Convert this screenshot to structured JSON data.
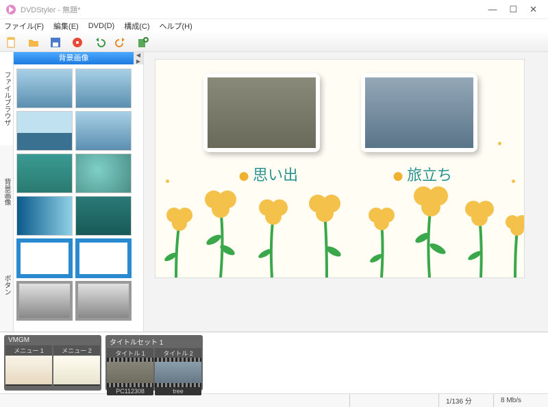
{
  "titlebar": {
    "text": "DVDStyler - 無題*"
  },
  "menubar": {
    "file": "ファイル(F)",
    "edit": "編集(E)",
    "dvd": "DVD(D)",
    "config": "構成(C)",
    "help": "ヘルプ(H)"
  },
  "sidetabs": {
    "filebrowser": "ファイルブラウザ",
    "background": "背景画像",
    "button": "ボタン"
  },
  "browser": {
    "header": "背景画像"
  },
  "canvas": {
    "label1": "思い出",
    "label2": "旅立ち"
  },
  "timeline": {
    "group1": {
      "header": "VMGM",
      "items": [
        {
          "header": "メニュー 1",
          "footer": ""
        },
        {
          "header": "メニュー 2",
          "footer": ""
        }
      ]
    },
    "group2": {
      "header": "タイトルセット 1",
      "items": [
        {
          "header": "タイトル 1",
          "footer": "PC112308"
        },
        {
          "header": "タイトル 2",
          "footer": "tree"
        }
      ]
    }
  },
  "status": {
    "time": "1/136 分",
    "bitrate": "8 Mb/s"
  },
  "icons": {
    "new": "new-file-icon",
    "open": "open-folder-icon",
    "save": "save-icon",
    "burn": "burn-disc-icon",
    "undo": "undo-icon",
    "redo": "redo-icon",
    "add": "add-icon"
  }
}
